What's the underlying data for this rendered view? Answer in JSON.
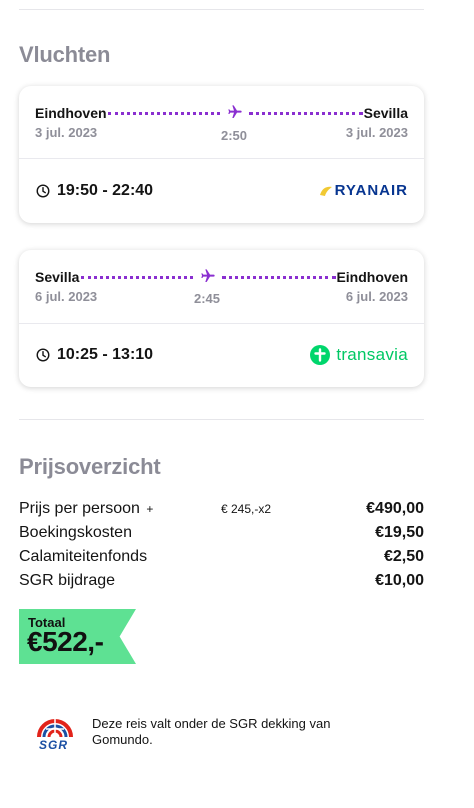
{
  "flights_section": {
    "title": "Vluchten",
    "outbound": {
      "from_city": "Eindhoven",
      "to_city": "Sevilla",
      "from_date": "3 jul. 2023",
      "to_date": "3 jul. 2023",
      "duration": "2:50",
      "times": "19:50 - 22:40",
      "airline": "RYANAIR"
    },
    "return": {
      "from_city": "Sevilla",
      "to_city": "Eindhoven",
      "from_date": "6 jul. 2023",
      "to_date": "6 jul. 2023",
      "duration": "2:45",
      "times": "10:25 - 13:10",
      "airline": "transavia"
    }
  },
  "price_section": {
    "title": "Prijsoverzicht",
    "rows": [
      {
        "label": "Prijs per persoon",
        "plus": "+",
        "sub": "€ 245,-x2",
        "amount": "€490,00"
      },
      {
        "label": "Boekingskosten",
        "amount": "€19,50"
      },
      {
        "label": "Calamiteitenfonds",
        "amount": "€2,50"
      },
      {
        "label": "SGR bijdrage",
        "amount": "€10,00"
      }
    ],
    "total_label": "Totaal",
    "total_amount": "€522,-"
  },
  "sgr": {
    "logo_text": "SGR",
    "note": "Deze reis valt onder de SGR dekking van Gomundo."
  },
  "colors": {
    "accent_purple": "#8a2fd0",
    "total_green": "#5ee193",
    "ryanair_blue": "#073590",
    "ryanair_yellow": "#f1c933",
    "transavia_green": "#00d66c",
    "muted_text": "#8f8f99"
  }
}
